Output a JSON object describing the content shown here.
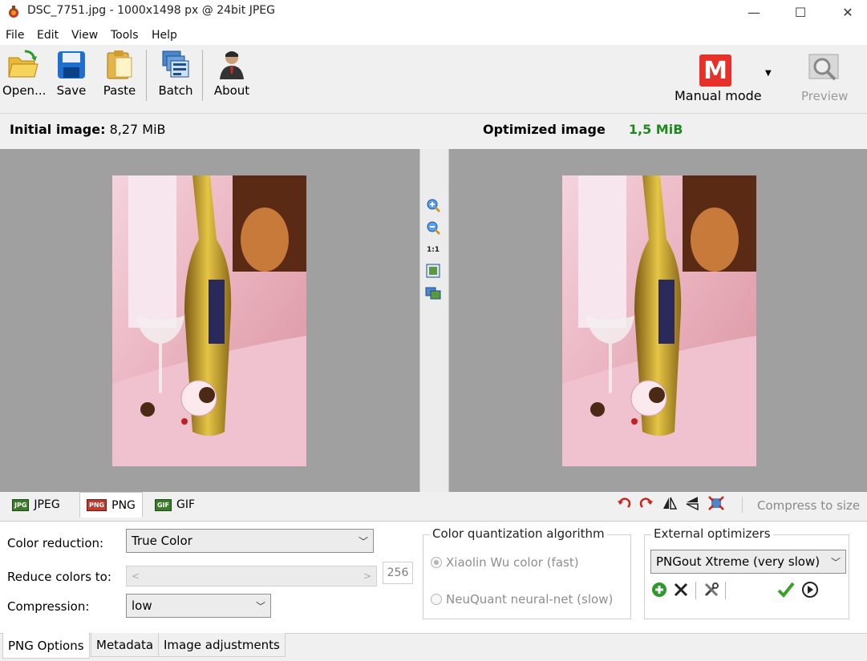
{
  "window": {
    "title": "DSC_7751.jpg - 1000x1498 px @ 24bit JPEG",
    "minimize": "—",
    "maximize": "☐",
    "close": "✕"
  },
  "menu": [
    "File",
    "Edit",
    "View",
    "Tools",
    "Help"
  ],
  "toolbar": {
    "open": "Open...",
    "save": "Save",
    "paste": "Paste",
    "batch": "Batch",
    "about": "About",
    "mode_letter": "M",
    "mode": "Manual mode",
    "preview": "Preview"
  },
  "initial": {
    "label": "Initial image:",
    "size": "8,27 MiB"
  },
  "optimized": {
    "label": "Optimized image",
    "size": "1,5 MiB"
  },
  "zoom": {
    "one_to_one": "1:1"
  },
  "format_tabs": [
    "JPEG",
    "PNG",
    "GIF"
  ],
  "format_tab_icons": [
    "JPG",
    "PNG",
    "GIF"
  ],
  "compress_to_size": "Compress to size",
  "options": {
    "color_reduction_label": "Color reduction:",
    "color_reduction_value": "True Color",
    "reduce_colors_label": "Reduce colors to:",
    "reduce_colors_value": "256",
    "compression_label": "Compression:",
    "compression_value": "low",
    "quant_title": "Color quantization algorithm",
    "quant_options": [
      "Xiaolin Wu color (fast)",
      "NeuQuant neural-net (slow)"
    ],
    "quant_selected": 0,
    "ext_title": "External optimizers",
    "ext_value": "PNGout Xtreme (very slow)"
  },
  "bottom_tabs": [
    "PNG Options",
    "Metadata",
    "Image adjustments"
  ],
  "colors": {
    "optimized_size": "#1e8a1e",
    "mode_badge": "#e8302a",
    "pane_bg": "#a0a0a0"
  }
}
